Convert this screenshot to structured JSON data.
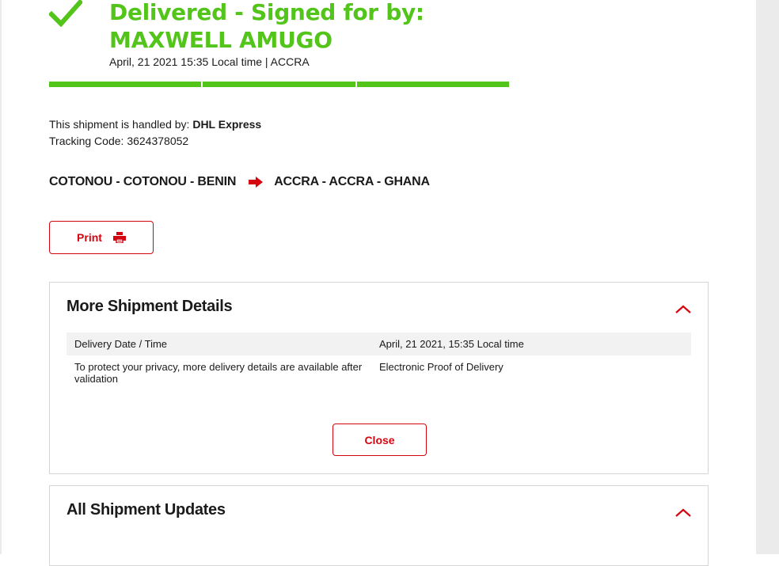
{
  "status": {
    "title": "Delivered - Signed for by: MAXWELL AMUGO",
    "meta": "April, 21 2021 15:35 Local time | ACCRA",
    "color": "#52c41a",
    "progress_segments_complete": 3
  },
  "shipment": {
    "handled_prefix": "This shipment is handled by:",
    "carrier": "DHL Express",
    "tracking_label": "Tracking Code:",
    "tracking_code": "3624378052"
  },
  "route": {
    "origin": "COTONOU - COTONOU - BENIN",
    "destination": "ACCRA - ACCRA - GHANA",
    "arrow_icon": "arrow-right-icon"
  },
  "print": {
    "label": "Print",
    "icon": "printer-icon"
  },
  "details_panel": {
    "title": "More Shipment Details",
    "rows": [
      {
        "label": "Delivery Date / Time",
        "value": "April, 21 2021, 15:35 Local time"
      },
      {
        "label": "To protect your privacy, more delivery details are available after validation",
        "value": "Electronic Proof of Delivery"
      }
    ],
    "close_label": "Close"
  },
  "updates_panel": {
    "title": "All Shipment Updates"
  },
  "colors": {
    "accent": "#d40511",
    "success": "#52c41a",
    "border": "#d6d6d6",
    "row_shade": "#f2f2f2"
  }
}
